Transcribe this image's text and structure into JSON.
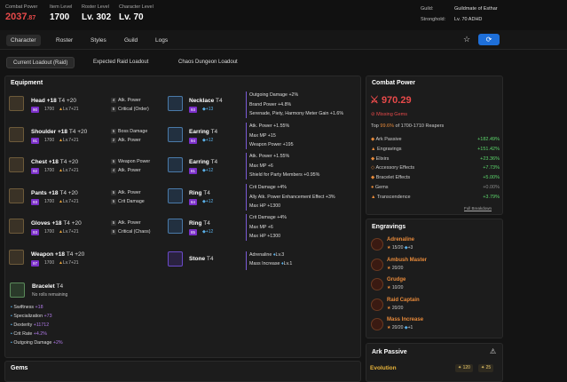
{
  "header": {
    "combat_power_label": "Combat Power",
    "combat_power_main": "2037",
    "combat_power_dec": ".87",
    "item_level_label": "Item Level",
    "item_level": "1700",
    "roster_level_label": "Roster Level",
    "roster_level": "Lv. 302",
    "character_level_label": "Character Level",
    "character_level": "Lv. 70",
    "guild_label": "Guild:",
    "guild_value": "Guildmate of Esthar",
    "stronghold_label": "Stronghold:",
    "stronghold_value": "Lv. 70 ADHD"
  },
  "nav": {
    "tabs": [
      "Character",
      "Roster",
      "Styles",
      "Guild",
      "Logs"
    ]
  },
  "subtabs": [
    "Current Loadout (Raid)",
    "Expected Raid Loadout",
    "Chaos Dungeon Loadout"
  ],
  "equipment": {
    "title": "Equipment",
    "left": [
      {
        "name": "Head +18",
        "tier": "T4 +20",
        "q": "90",
        "il": "1700",
        "lv": "Lv.7+21",
        "stats": [
          {
            "n": "4",
            "t": "Atk. Power"
          },
          {
            "n": "5",
            "t": "Critical (Order)"
          }
        ]
      },
      {
        "name": "Shoulder +18",
        "tier": "T4 +20",
        "q": "91",
        "il": "1700",
        "lv": "Lv.7+21",
        "stats": [
          {
            "n": "5",
            "t": "Boss Damage"
          },
          {
            "n": "2",
            "t": "Atk. Power"
          }
        ]
      },
      {
        "name": "Chest +18",
        "tier": "T4 +20",
        "q": "92",
        "il": "1700",
        "lv": "Lv.7+21",
        "stats": [
          {
            "n": "5",
            "t": "Weapon Power"
          },
          {
            "n": "4",
            "t": "Atk. Power"
          }
        ]
      },
      {
        "name": "Pants +18",
        "tier": "T4 +20",
        "q": "93",
        "il": "1700",
        "lv": "Lv.7+21",
        "stats": [
          {
            "n": "5",
            "t": "Atk. Power"
          },
          {
            "n": "5",
            "t": "Crit Damage"
          }
        ]
      },
      {
        "name": "Gloves +18",
        "tier": "T4 +20",
        "q": "93",
        "il": "1700",
        "lv": "Lv.7+21",
        "stats": [
          {
            "n": "5",
            "t": "Atk. Power"
          },
          {
            "n": "5",
            "t": "Critical (Chaos)"
          }
        ]
      },
      {
        "name": "Weapon +18",
        "tier": "T4 +20",
        "q": "97",
        "il": "1700",
        "lv": "Lv.7+21",
        "stats": []
      }
    ],
    "right": [
      {
        "name": "Necklace",
        "tier": "T4",
        "q": "93",
        "extra": "+13",
        "lines": [
          "Outgoing Damage +2%",
          "Brand Power +4.8%",
          "Serenade, Piety, Harmony Meter Gain +1.6%"
        ]
      },
      {
        "name": "Earring",
        "tier": "T4",
        "q": "94",
        "extra": "+12",
        "lines": [
          "Atk. Power +1.55%",
          "Max MP +15",
          "Weapon Power +195"
        ]
      },
      {
        "name": "Earring",
        "tier": "T4",
        "q": "81",
        "extra": "+12",
        "lines": [
          "Atk. Power +1.55%",
          "Max MP +6",
          "Shield for Party Members +0.95%"
        ]
      },
      {
        "name": "Ring",
        "tier": "T4",
        "q": "84",
        "extra": "+12",
        "lines": [
          "Crit Damage +4%",
          "Ally Atk. Power Enhancement Effect +3%",
          "Max HP +1300"
        ]
      },
      {
        "name": "Ring",
        "tier": "T4",
        "q": "85",
        "extra": "+12",
        "lines": [
          "Crit Damage +4%",
          "Max MP +6",
          "Max HP +1300"
        ]
      }
    ],
    "stone": {
      "name": "Stone",
      "tier": "T4",
      "line1": "Adrenaline",
      "line1b": "Lv.3",
      "line2": "Mass Increase",
      "line2b": "Lv.1"
    },
    "bracelet": {
      "name": "Bracelet",
      "tier": "T4",
      "sub": "No rolls remaining",
      "stats": [
        {
          "label": "Swiftness",
          "val": "+18"
        },
        {
          "label": "Specialization",
          "val": "+73"
        },
        {
          "label": "Dexterity",
          "val": "+11712"
        },
        {
          "label": "Crit Rate",
          "val": "+4.2%"
        },
        {
          "label": "Outgoing Damage",
          "val": "+2%"
        }
      ]
    }
  },
  "combat": {
    "title": "Combat Power",
    "value": "970.29",
    "missing": "Missing Gems",
    "top_prefix": "Top ",
    "top_pct": "99.6%",
    "top_suffix": " of 1700-1710 Reapers",
    "rows": [
      {
        "l": "Ark Passive",
        "v": "+182.49%"
      },
      {
        "l": "Engravings",
        "v": "+151.42%"
      },
      {
        "l": "Elixirs",
        "v": "+23.36%"
      },
      {
        "l": "Accessory Effects",
        "v": "+7.73%"
      },
      {
        "l": "Bracelet Effects",
        "v": "+5.00%"
      },
      {
        "l": "Gems",
        "v": "+0.00%"
      },
      {
        "l": "Transcendence",
        "v": "+3.79%"
      }
    ],
    "breakdown": "Full Breakdown"
  },
  "engravings": {
    "title": "Engravings",
    "items": [
      {
        "name": "Adrenaline",
        "a": "15/20",
        "b": "+3"
      },
      {
        "name": "Ambush Master",
        "a": "20/20",
        "b": ""
      },
      {
        "name": "Grudge",
        "a": "10/20",
        "b": ""
      },
      {
        "name": "Raid Captain",
        "a": "20/20",
        "b": ""
      },
      {
        "name": "Mass Increase",
        "a": "20/20",
        "b": "+1"
      }
    ]
  },
  "ark": {
    "title": "Ark Passive",
    "evo": "Evolution",
    "p1": "120",
    "p2": "25"
  },
  "gems": {
    "title": "Gems"
  },
  "colors": {
    "accent": "#e84a4a",
    "green": "#5cd66b",
    "orange": "#e88a3a",
    "blue": "#1e6fd9",
    "purple": "#7b2fc9"
  }
}
